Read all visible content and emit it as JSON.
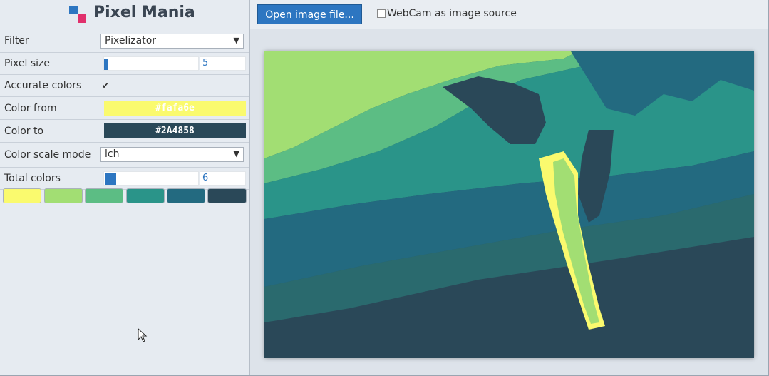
{
  "app": {
    "title": "Pixel Mania"
  },
  "toolbar": {
    "open_label": "Open image file...",
    "webcam_label": "WebCam as image source"
  },
  "controls": {
    "filter": {
      "label": "Filter",
      "value": "Pixelizator"
    },
    "pixel_size": {
      "label": "Pixel size",
      "value": "5",
      "level": 0.04
    },
    "accurate_colors": {
      "label": "Accurate colors",
      "checked": true
    },
    "color_from": {
      "label": "Color from",
      "value": "#fafa6e"
    },
    "color_to": {
      "label": "Color to",
      "value": "#2A4858"
    },
    "color_scale_mode": {
      "label": "Color scale mode",
      "value": "lch"
    },
    "total_colors": {
      "label": "Total colors",
      "value": "6",
      "level": 0.1
    }
  },
  "palette": [
    "#fafa6e",
    "#a2de73",
    "#5cbd84",
    "#2a9489",
    "#236a80",
    "#2a4858"
  ]
}
